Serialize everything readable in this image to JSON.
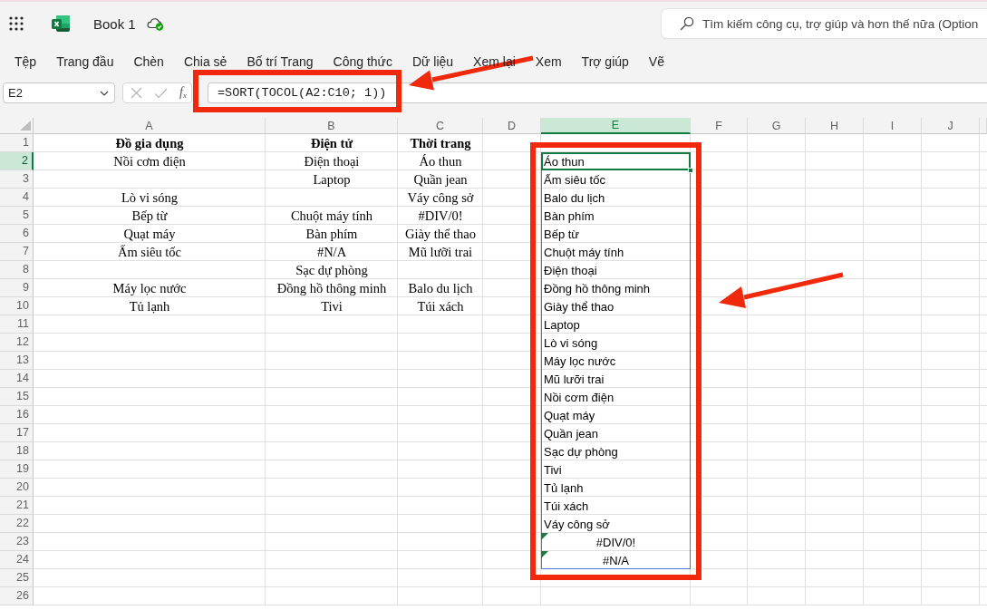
{
  "title_bar": {
    "document_title": "Book 1",
    "search": {
      "placeholder": "Tìm kiếm công cụ, trợ giúp và hơn thế nữa (Option"
    }
  },
  "ribbon_tabs": [
    "Tệp",
    "Trang đầu",
    "Chèn",
    "Chia sẻ",
    "Bố trí Trang",
    "Công thức",
    "Dữ liệu",
    "Xem lại",
    "Xem",
    "Trợ giúp",
    "Vẽ"
  ],
  "formula_bar": {
    "name_box": "E2",
    "function_button": "f$_{x}$",
    "formula": "=SORT(TOCOL(A2:C10; 1))"
  },
  "sheet": {
    "columns": [
      {
        "label": "A",
        "selected": false
      },
      {
        "label": "B",
        "selected": false
      },
      {
        "label": "C",
        "selected": false
      },
      {
        "label": "D",
        "selected": false
      },
      {
        "label": "E",
        "selected": true
      },
      {
        "label": "F",
        "selected": false
      },
      {
        "label": "G",
        "selected": false
      },
      {
        "label": "H",
        "selected": false
      },
      {
        "label": "I",
        "selected": false
      },
      {
        "label": "J",
        "selected": false
      }
    ],
    "rows": [
      {
        "label": "1",
        "selected": false,
        "cells": [
          {
            "text": "Đồ gia dụng",
            "kind": "heading",
            "selected": false,
            "flagged": false,
            "spill": false
          },
          {
            "text": "Điện tử",
            "kind": "heading",
            "selected": false,
            "flagged": false,
            "spill": false
          },
          {
            "text": "Thời trang",
            "kind": "heading",
            "selected": false,
            "flagged": false,
            "spill": false
          }
        ]
      },
      {
        "label": "2",
        "selected": true,
        "cells": [
          {
            "text": "Nồi cơm điện",
            "kind": "entry",
            "selected": false,
            "flagged": false,
            "spill": false
          },
          {
            "text": "Điện thoại",
            "kind": "entry",
            "selected": false,
            "flagged": false,
            "spill": false
          },
          {
            "text": "Áo thun",
            "kind": "entry",
            "selected": false,
            "flagged": false,
            "spill": false
          },
          null,
          {
            "text": "Áo thun",
            "kind": "result",
            "selected": true,
            "flagged": false,
            "spill": true
          }
        ]
      },
      {
        "label": "3",
        "selected": false,
        "cells": [
          null,
          {
            "text": "Laptop",
            "kind": "entry",
            "selected": false,
            "flagged": false,
            "spill": false
          },
          {
            "text": "Quần jean",
            "kind": "entry",
            "selected": false,
            "flagged": false,
            "spill": false
          },
          null,
          {
            "text": "Ấm siêu tốc",
            "kind": "result",
            "selected": false,
            "flagged": false,
            "spill": true
          }
        ]
      },
      {
        "label": "4",
        "selected": false,
        "cells": [
          {
            "text": "Lò vi sóng",
            "kind": "entry",
            "selected": false,
            "flagged": false,
            "spill": false
          },
          null,
          {
            "text": "Váy công sở",
            "kind": "entry",
            "selected": false,
            "flagged": false,
            "spill": false
          },
          null,
          {
            "text": "Balo du lịch",
            "kind": "result",
            "selected": false,
            "flagged": false,
            "spill": true
          }
        ]
      },
      {
        "label": "5",
        "selected": false,
        "cells": [
          {
            "text": "Bếp từ",
            "kind": "entry",
            "selected": false,
            "flagged": false,
            "spill": false
          },
          {
            "text": "Chuột máy tính",
            "kind": "entry",
            "selected": false,
            "flagged": false,
            "spill": false
          },
          {
            "text": "#DIV/0!",
            "kind": "entry",
            "selected": false,
            "flagged": false,
            "spill": false
          },
          null,
          {
            "text": "Bàn phím",
            "kind": "result",
            "selected": false,
            "flagged": false,
            "spill": true
          }
        ]
      },
      {
        "label": "6",
        "selected": false,
        "cells": [
          {
            "text": "Quạt máy",
            "kind": "entry",
            "selected": false,
            "flagged": false,
            "spill": false
          },
          {
            "text": "Bàn phím",
            "kind": "entry",
            "selected": false,
            "flagged": false,
            "spill": false
          },
          {
            "text": "Giày thể thao",
            "kind": "entry",
            "selected": false,
            "flagged": false,
            "spill": false
          },
          null,
          {
            "text": "Bếp từ",
            "kind": "result",
            "selected": false,
            "flagged": false,
            "spill": true
          }
        ]
      },
      {
        "label": "7",
        "selected": false,
        "cells": [
          {
            "text": "Ấm siêu tốc",
            "kind": "entry",
            "selected": false,
            "flagged": false,
            "spill": false
          },
          {
            "text": "#N/A",
            "kind": "entry",
            "selected": false,
            "flagged": false,
            "spill": false
          },
          {
            "text": "Mũ lưỡi trai",
            "kind": "entry",
            "selected": false,
            "flagged": false,
            "spill": false
          },
          null,
          {
            "text": "Chuột máy tính",
            "kind": "result",
            "selected": false,
            "flagged": false,
            "spill": true
          }
        ]
      },
      {
        "label": "8",
        "selected": false,
        "cells": [
          null,
          {
            "text": "Sạc dự phòng",
            "kind": "entry",
            "selected": false,
            "flagged": false,
            "spill": false
          },
          null,
          null,
          {
            "text": "Điện thoại",
            "kind": "result",
            "selected": false,
            "flagged": false,
            "spill": true
          }
        ]
      },
      {
        "label": "9",
        "selected": false,
        "cells": [
          {
            "text": "Máy lọc nước",
            "kind": "entry",
            "selected": false,
            "flagged": false,
            "spill": false
          },
          {
            "text": "Đồng hồ thông minh",
            "kind": "entry",
            "selected": false,
            "flagged": false,
            "spill": false
          },
          {
            "text": "Balo du lịch",
            "kind": "entry",
            "selected": false,
            "flagged": false,
            "spill": false
          },
          null,
          {
            "text": "Đồng hồ thông minh",
            "kind": "result",
            "selected": false,
            "flagged": false,
            "spill": true
          }
        ]
      },
      {
        "label": "10",
        "selected": false,
        "cells": [
          {
            "text": "Tủ lạnh",
            "kind": "entry",
            "selected": false,
            "flagged": false,
            "spill": false
          },
          {
            "text": "Tivi",
            "kind": "entry",
            "selected": false,
            "flagged": false,
            "spill": false
          },
          {
            "text": "Túi xách",
            "kind": "entry",
            "selected": false,
            "flagged": false,
            "spill": false
          },
          null,
          {
            "text": "Giày thể thao",
            "kind": "result",
            "selected": false,
            "flagged": false,
            "spill": true
          }
        ]
      },
      {
        "label": "11",
        "selected": false,
        "cells": [
          null,
          null,
          null,
          null,
          {
            "text": "Laptop",
            "kind": "result",
            "selected": false,
            "flagged": false,
            "spill": true
          }
        ]
      },
      {
        "label": "12",
        "selected": false,
        "cells": [
          null,
          null,
          null,
          null,
          {
            "text": "Lò vi sóng",
            "kind": "result",
            "selected": false,
            "flagged": false,
            "spill": true
          }
        ]
      },
      {
        "label": "13",
        "selected": false,
        "cells": [
          null,
          null,
          null,
          null,
          {
            "text": "Máy lọc nước",
            "kind": "result",
            "selected": false,
            "flagged": false,
            "spill": true
          }
        ]
      },
      {
        "label": "14",
        "selected": false,
        "cells": [
          null,
          null,
          null,
          null,
          {
            "text": "Mũ lưỡi trai",
            "kind": "result",
            "selected": false,
            "flagged": false,
            "spill": true
          }
        ]
      },
      {
        "label": "15",
        "selected": false,
        "cells": [
          null,
          null,
          null,
          null,
          {
            "text": "Nồi cơm điện",
            "kind": "result",
            "selected": false,
            "flagged": false,
            "spill": true
          }
        ]
      },
      {
        "label": "16",
        "selected": false,
        "cells": [
          null,
          null,
          null,
          null,
          {
            "text": "Quạt máy",
            "kind": "result",
            "selected": false,
            "flagged": false,
            "spill": true
          }
        ]
      },
      {
        "label": "17",
        "selected": false,
        "cells": [
          null,
          null,
          null,
          null,
          {
            "text": "Quần jean",
            "kind": "result",
            "selected": false,
            "flagged": false,
            "spill": true
          }
        ]
      },
      {
        "label": "18",
        "selected": false,
        "cells": [
          null,
          null,
          null,
          null,
          {
            "text": "Sạc dự phòng",
            "kind": "result",
            "selected": false,
            "flagged": false,
            "spill": true
          }
        ]
      },
      {
        "label": "19",
        "selected": false,
        "cells": [
          null,
          null,
          null,
          null,
          {
            "text": "Tivi",
            "kind": "result",
            "selected": false,
            "flagged": false,
            "spill": true
          }
        ]
      },
      {
        "label": "20",
        "selected": false,
        "cells": [
          null,
          null,
          null,
          null,
          {
            "text": "Tủ lạnh",
            "kind": "result",
            "selected": false,
            "flagged": false,
            "spill": true
          }
        ]
      },
      {
        "label": "21",
        "selected": false,
        "cells": [
          null,
          null,
          null,
          null,
          {
            "text": "Túi xách",
            "kind": "result",
            "selected": false,
            "flagged": false,
            "spill": true
          }
        ]
      },
      {
        "label": "22",
        "selected": false,
        "cells": [
          null,
          null,
          null,
          null,
          {
            "text": "Váy công sở",
            "kind": "result",
            "selected": false,
            "flagged": false,
            "spill": true
          }
        ]
      },
      {
        "label": "23",
        "selected": false,
        "cells": [
          null,
          null,
          null,
          null,
          {
            "text": "#DIV/0!",
            "kind": "result",
            "selected": false,
            "flagged": true,
            "spill": true
          }
        ]
      },
      {
        "label": "24",
        "selected": false,
        "cells": [
          null,
          null,
          null,
          null,
          {
            "text": "#N/A",
            "kind": "result",
            "selected": false,
            "flagged": true,
            "spill": true
          }
        ]
      },
      {
        "label": "25",
        "selected": false
      },
      {
        "label": "26",
        "selected": false
      }
    ]
  }
}
